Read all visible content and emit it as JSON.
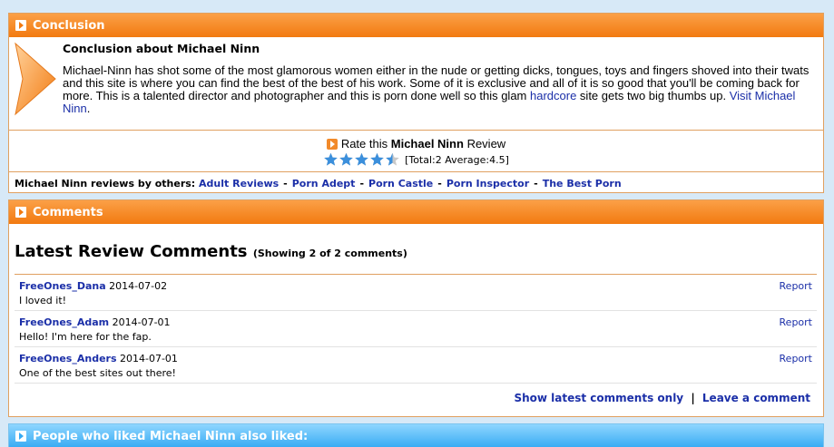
{
  "conclusion": {
    "header": "Conclusion",
    "title": "Conclusion about Michael Ninn",
    "text_before_link": "Michael-Ninn has shot some of the most glamorous women either in the nude or getting dicks, tongues, toys and fingers shoved into their twats and this site is where you can find the best of the best of his work. Some of it is exclusive and all of it is so good that you'll be coming back for more. This is a talented director and photographer and this is porn done well so this glam ",
    "hardcore_link": "hardcore",
    "text_after_link": " site gets two big thumbs up. ",
    "visit_link": "Visit Michael Ninn",
    "period": "."
  },
  "rating": {
    "prefix": "Rate this",
    "name": "Michael Ninn",
    "suffix": "Review",
    "stars_value": 4.5,
    "stars_max": 5,
    "total_text": "[Total:2  Average:4.5]"
  },
  "others": {
    "label": "Michael Ninn reviews by others:",
    "links": [
      "Adult Reviews",
      "Porn Adept",
      "Porn Castle",
      "Porn Inspector",
      "The Best Porn"
    ],
    "separator": "-"
  },
  "comments": {
    "header": "Comments",
    "title": "Latest Review Comments",
    "count_text": "(Showing 2 of 2 comments)",
    "items": [
      {
        "user": "FreeOnes_Dana",
        "date": "2014-07-02",
        "text": "I loved it!",
        "report": "Report"
      },
      {
        "user": "FreeOnes_Adam",
        "date": "2014-07-01",
        "text": "Hello! I'm here for the fap.",
        "report": "Report"
      },
      {
        "user": "FreeOnes_Anders",
        "date": "2014-07-01",
        "text": "One of the best sites out there!",
        "report": "Report"
      }
    ],
    "show_latest": "Show latest comments only",
    "footer_sep": "|",
    "leave_comment": "Leave a comment"
  },
  "liked": {
    "header": "People who liked Michael Ninn also liked:"
  },
  "colors": {
    "orange_header": "#f27a10",
    "blue_header": "#36aaf3",
    "link": "#1b2fa8",
    "star": "#3b8fdc",
    "background": "#d7e9f7"
  }
}
